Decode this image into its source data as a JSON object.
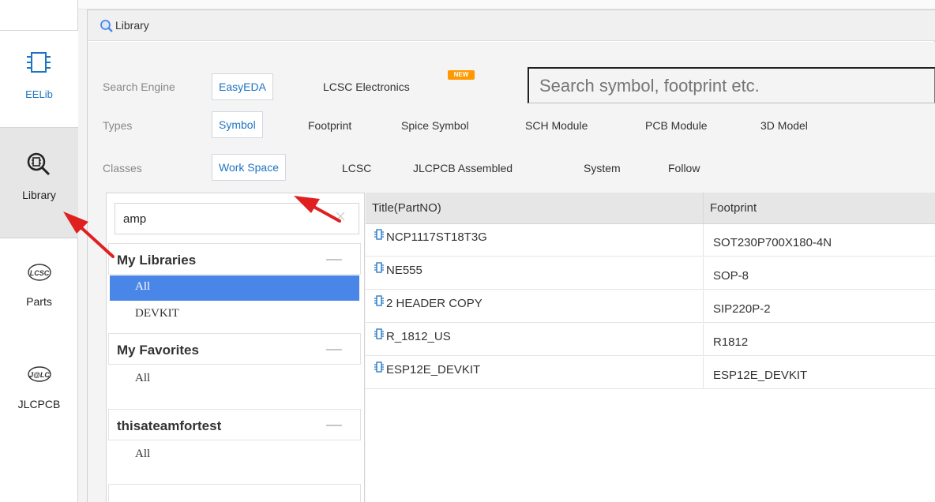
{
  "sidebar": {
    "tabs": [
      {
        "label": "EELib",
        "icon": "chip-icon"
      },
      {
        "label": "Library",
        "icon": "library-search-icon"
      },
      {
        "label": "Parts",
        "icon": "lcsc-logo-icon"
      },
      {
        "label": "JLCPCB",
        "icon": "jlc-logo-icon"
      }
    ],
    "active": "Library"
  },
  "dialog": {
    "title": "Library",
    "search_engine": {
      "label": "Search Engine",
      "options": [
        "EasyEDA",
        "LCSC Electronics"
      ],
      "selected": "EasyEDA",
      "new_badge": "NEW"
    },
    "search": {
      "placeholder": "Search symbol, footprint etc."
    },
    "types": {
      "label": "Types",
      "options": [
        "Symbol",
        "Footprint",
        "Spice Symbol",
        "SCH Module",
        "PCB Module",
        "3D Model"
      ],
      "selected": "Symbol"
    },
    "classes": {
      "label": "Classes",
      "options": [
        "Work Space",
        "LCSC",
        "JLCPCB Assembled",
        "System",
        "Follow"
      ],
      "selected": "Work Space"
    },
    "left_panel": {
      "search_value": "amp",
      "groups": [
        {
          "title": "My Libraries",
          "items": [
            "All",
            "DEVKIT"
          ],
          "selected": "All"
        },
        {
          "title": "My Favorites",
          "items": [
            "All"
          ]
        },
        {
          "title": "thisateamfortest",
          "items": [
            "All"
          ]
        }
      ]
    },
    "table": {
      "columns": [
        "Title(PartNO)",
        "Footprint"
      ],
      "rows": [
        {
          "title": "NCP1117ST18T3G",
          "footprint": "SOT230P700X180-4N"
        },
        {
          "title": "NE555",
          "footprint": "SOP-8"
        },
        {
          "title": "2 HEADER COPY",
          "footprint": "SIP220P-2"
        },
        {
          "title": "R_1812_US",
          "footprint": "R1812"
        },
        {
          "title": "ESP12E_DEVKIT",
          "footprint": "ESP12E_DEVKIT"
        }
      ]
    }
  },
  "colors": {
    "accent": "#1e74c4",
    "selected_bg": "#4a86e8",
    "annotation_arrow": "#e02020",
    "new_badge": "#ff9900"
  }
}
